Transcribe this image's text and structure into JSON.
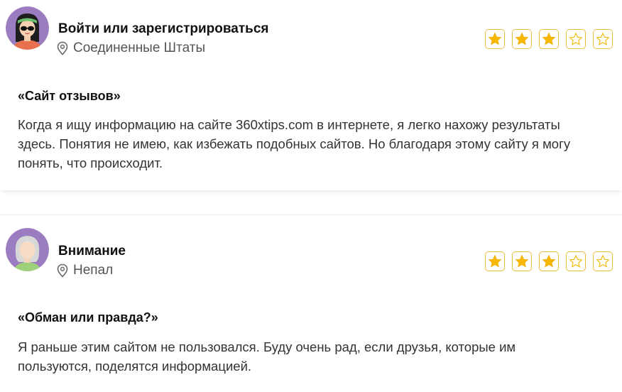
{
  "reviews": [
    {
      "author": "Войти или зарегистрироваться",
      "location": "Соединенные Штаты",
      "avatar": "woman-sunglasses-avatar",
      "rating": 3,
      "rating_max": 5,
      "title": "«Сайт отзывов»",
      "text": "Когда я ищу информацию на сайте 360xtips.com в интернете, я легко нахожу результаты здесь. Понятия не имею, как избежать подобных сайтов. Но благодаря этому сайту я могу понять, что происходит."
    },
    {
      "author": "Внимание",
      "location": "Непал",
      "avatar": "grey-hair-avatar",
      "rating": 3,
      "rating_max": 5,
      "title": "«Обман или правда?»",
      "text": "Я раньше этим сайтом не пользовался. Буду очень рад, если друзья, которые им пользуются, поделятся информацией."
    }
  ],
  "colors": {
    "star_filled": "#f6b800",
    "star_border": "#e8c040",
    "avatar_bg": "#9b7cc0"
  },
  "icons": {
    "location": "map-pin-icon",
    "star": "star-icon"
  }
}
